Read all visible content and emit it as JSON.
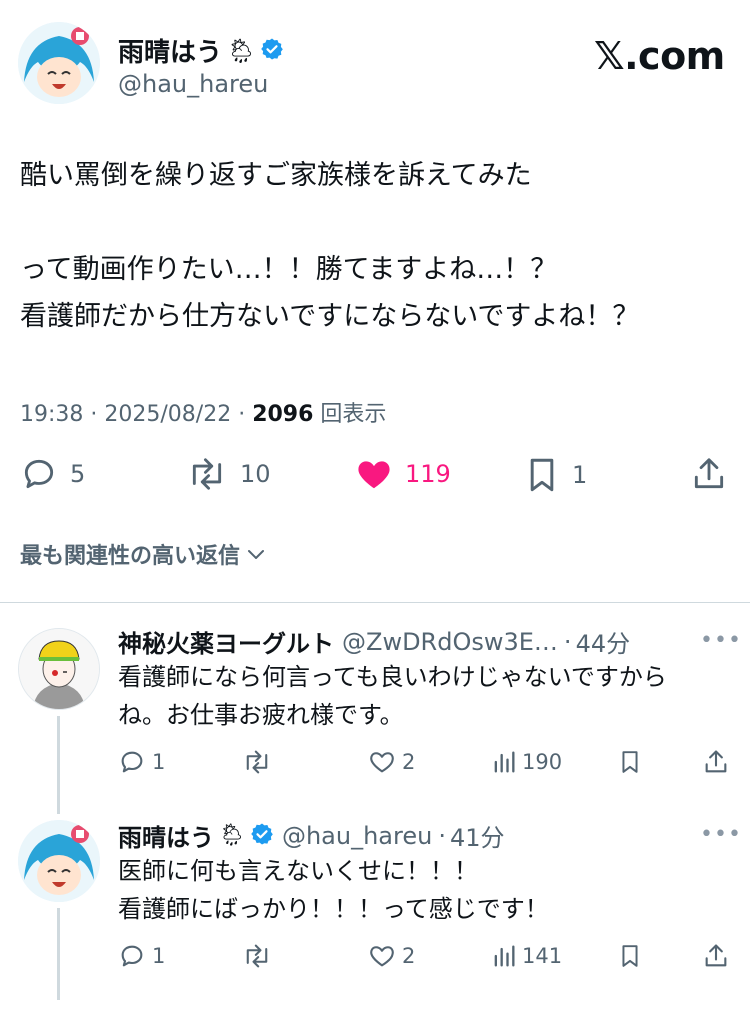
{
  "brand": {
    "logo_text": "𝕏.com"
  },
  "tweet": {
    "author_name": "雨晴はう",
    "author_emoji": "🌦",
    "handle": "@hau_hareu",
    "text": "酷い罵倒を繰り返すご家族様を訴えてみた\n\nって動画作りたい…！！勝てますよね…！？\n看護師だから仕方ないですにならないですよね！？",
    "time": "19:38",
    "date": "2025/08/22",
    "views": "2096",
    "views_label": "回表示",
    "stats": {
      "replies": "5",
      "retweets": "10",
      "likes": "119",
      "bookmarks": "1"
    }
  },
  "sort_label": "最も関連性の高い返信",
  "replies": [
    {
      "name": "神秘火薬ヨーグルト",
      "handle": "@ZwDRdOsw3E…",
      "time": "44分",
      "text": "看護師になら何言っても良いわけじゃないですから\nね。お仕事お疲れ様です。",
      "replies": "1",
      "likes": "2",
      "views": "190"
    },
    {
      "name": "雨晴はう",
      "emoji": "🌦",
      "handle": "@hau_hareu",
      "time": "41分",
      "text": "医師に何も言えないくせに！！！\n看護師にばっかり！！！って感じです！",
      "replies": "1",
      "likes": "2",
      "views": "141"
    }
  ],
  "colors": {
    "like": "#f91880",
    "verified": "#1d9bf0",
    "muted": "#536471"
  }
}
